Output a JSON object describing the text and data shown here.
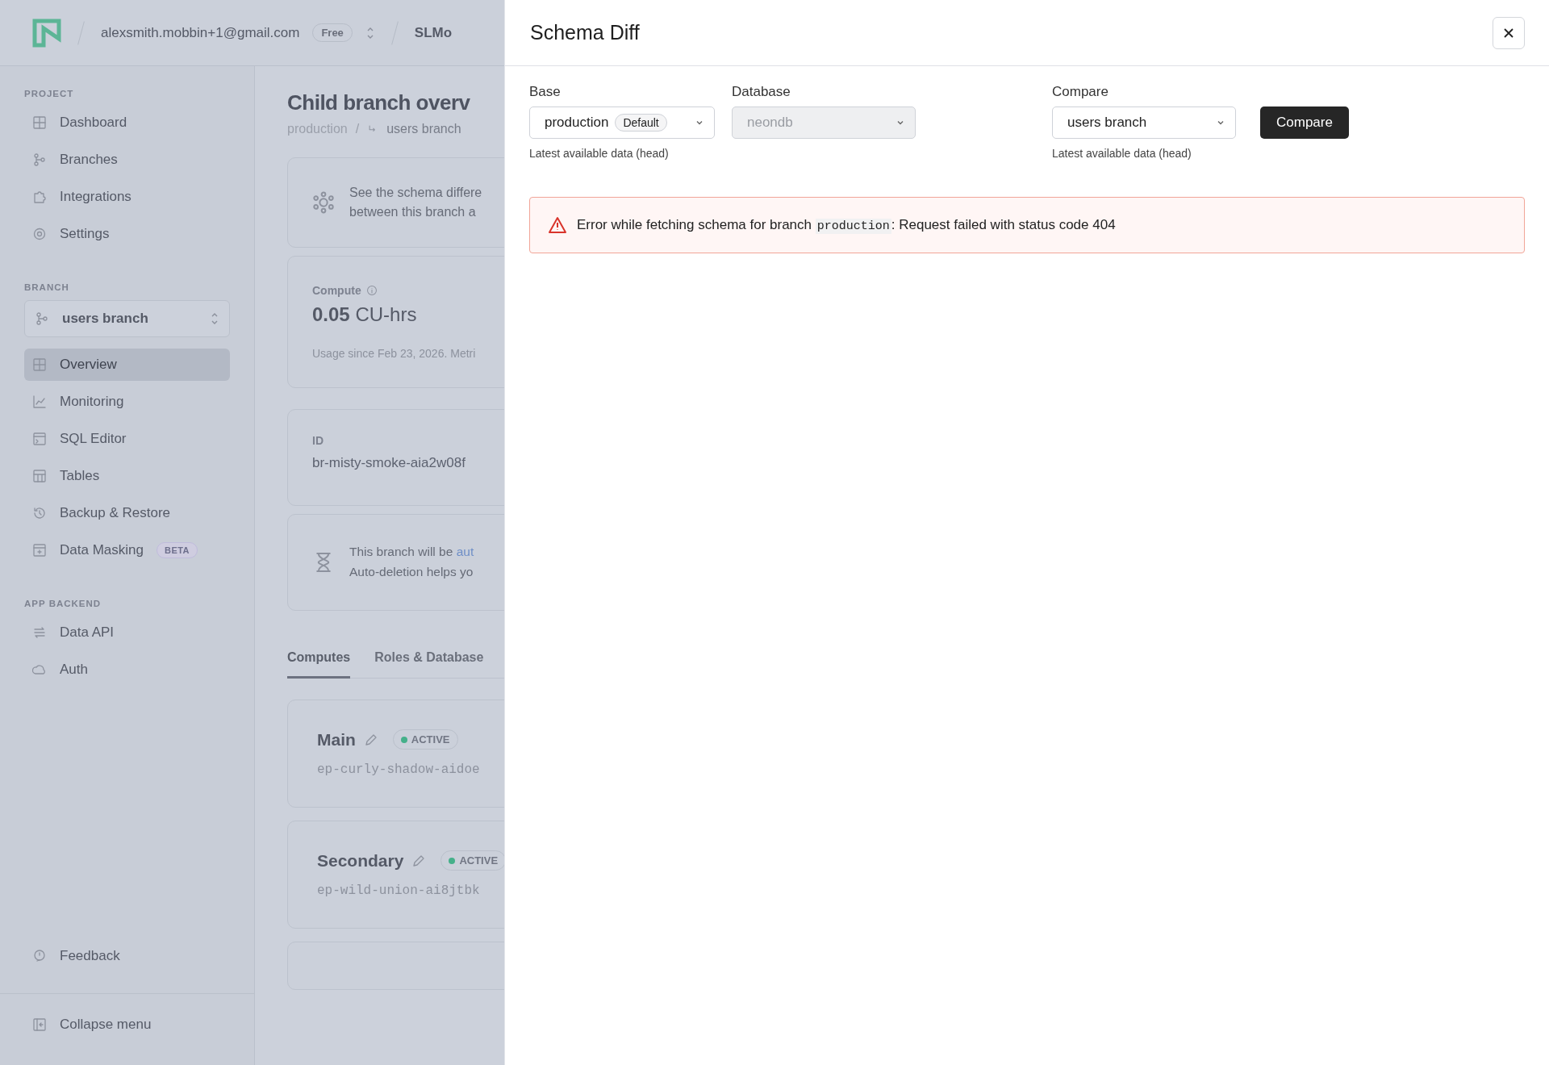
{
  "topbar": {
    "account": "alexsmith.mobbin+1@gmail.com",
    "plan": "Free",
    "project": "SLMo"
  },
  "sidebar": {
    "sections": [
      {
        "heading": "PROJECT",
        "items": [
          {
            "label": "Dashboard",
            "selected": false
          },
          {
            "label": "Branches",
            "selected": false
          },
          {
            "label": "Integrations",
            "selected": false
          },
          {
            "label": "Settings",
            "selected": false
          }
        ]
      },
      {
        "heading": "BRANCH",
        "branch_selector": "users branch",
        "items": [
          {
            "label": "Overview",
            "selected": true
          },
          {
            "label": "Monitoring",
            "selected": false
          },
          {
            "label": "SQL Editor",
            "selected": false
          },
          {
            "label": "Tables",
            "selected": false
          },
          {
            "label": "Backup & Restore",
            "selected": false
          },
          {
            "label": "Data Masking",
            "selected": false,
            "badge": "BETA"
          }
        ]
      },
      {
        "heading": "APP BACKEND",
        "items": [
          {
            "label": "Data API",
            "selected": false
          },
          {
            "label": "Auth",
            "selected": false
          }
        ]
      }
    ],
    "feedback": "Feedback",
    "collapse": "Collapse menu"
  },
  "main": {
    "title": "Child branch overv",
    "breadcrumb": {
      "parent": "production",
      "separator": "/",
      "current": "users branch"
    },
    "schema_card": [
      "See the schema differe",
      "between this branch a"
    ],
    "compute_card": {
      "label": "Compute",
      "value": "0.05",
      "unit": "CU-hrs",
      "note": "Usage since Feb 23, 2026. Metri"
    },
    "id_card": {
      "label": "ID",
      "value": "br-misty-smoke-aia2w08f"
    },
    "deletion_card": {
      "text": "This branch will be ",
      "link": "aut",
      "note": "Auto-deletion helps yo"
    },
    "tabs": [
      {
        "label": "Computes",
        "selected": true
      },
      {
        "label": "Roles & Database",
        "selected": false
      }
    ],
    "computes": [
      {
        "name": "Main",
        "status": "ACTIVE",
        "endpoint": "ep-curly-shadow-aidoe"
      },
      {
        "name": "Secondary",
        "status": "ACTIVE",
        "endpoint": "ep-wild-union-ai8jtbk"
      }
    ]
  },
  "dialog": {
    "title": "Schema Diff",
    "base": {
      "label": "Base",
      "value": "production",
      "badge": "Default",
      "helper": "Latest available data (head)"
    },
    "database": {
      "label": "Database",
      "value": "neondb",
      "disabled": true
    },
    "compare": {
      "label": "Compare",
      "value": "users branch",
      "helper": "Latest available data (head)"
    },
    "button": "Compare",
    "error": {
      "before": "Error while fetching schema for branch ",
      "code": "production",
      "after": ": Request failed with status code 404"
    }
  }
}
